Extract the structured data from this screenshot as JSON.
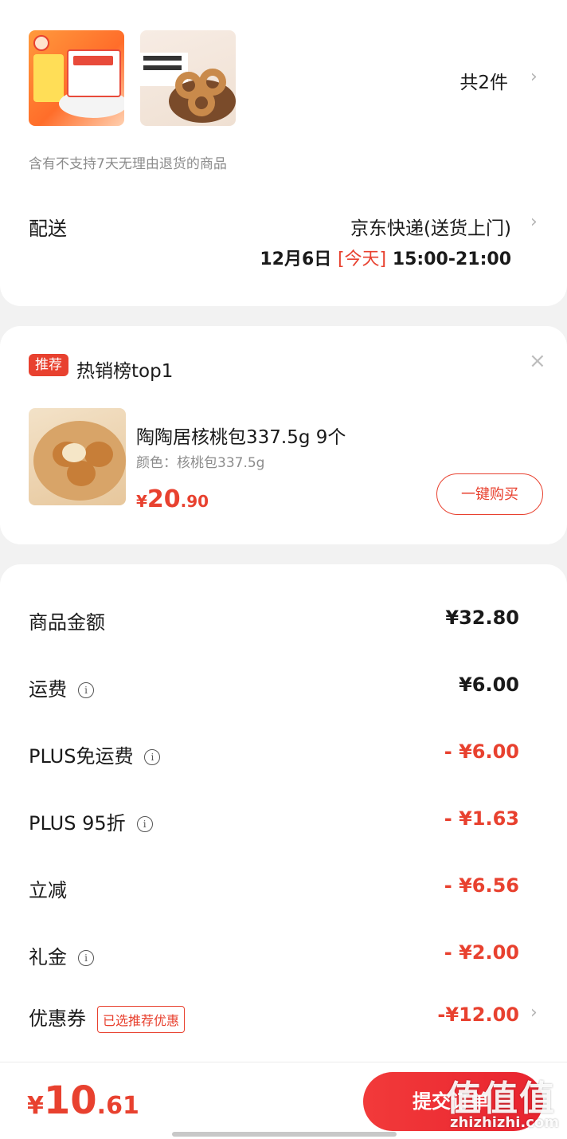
{
  "order_items": {
    "count_label": "共2件",
    "notice": "含有不支持7天无理由退货的商品"
  },
  "delivery": {
    "label": "配送",
    "method": "京东快递(送货上门)",
    "date": "12月6日",
    "today": "[今天]",
    "time": "15:00-21:00"
  },
  "recommend": {
    "tag": "推荐",
    "title": "热销榜top1",
    "product_name": "陶陶居核桃包337.5g 9个",
    "product_spec": "颜色：核桃包337.5g",
    "price_symbol": "¥",
    "price_int": "20",
    "price_dec": ".90",
    "buy_label": "一键购买"
  },
  "summary": {
    "rows": [
      {
        "label": "商品金额",
        "value": "¥32.80"
      },
      {
        "label": "运费",
        "value": "¥6.00"
      },
      {
        "label": "PLUS免运费",
        "value": "- ¥6.00"
      },
      {
        "label": "PLUS 95折",
        "value": "- ¥1.63"
      },
      {
        "label": "立减",
        "value": "- ¥6.56"
      },
      {
        "label": "礼金",
        "value": "- ¥2.00"
      },
      {
        "label": "优惠券",
        "value": "-¥12.00",
        "tag": "已选推荐优惠"
      }
    ]
  },
  "bottom_bar": {
    "currency": "¥",
    "total_int": "10",
    "total_dec": ".61",
    "submit_label": "提交订单"
  },
  "watermark": {
    "main": "值值值",
    "site": "zhizhizhi.com"
  },
  "colors": {
    "accent": "#e8412f",
    "background": "#f2f2f2"
  }
}
